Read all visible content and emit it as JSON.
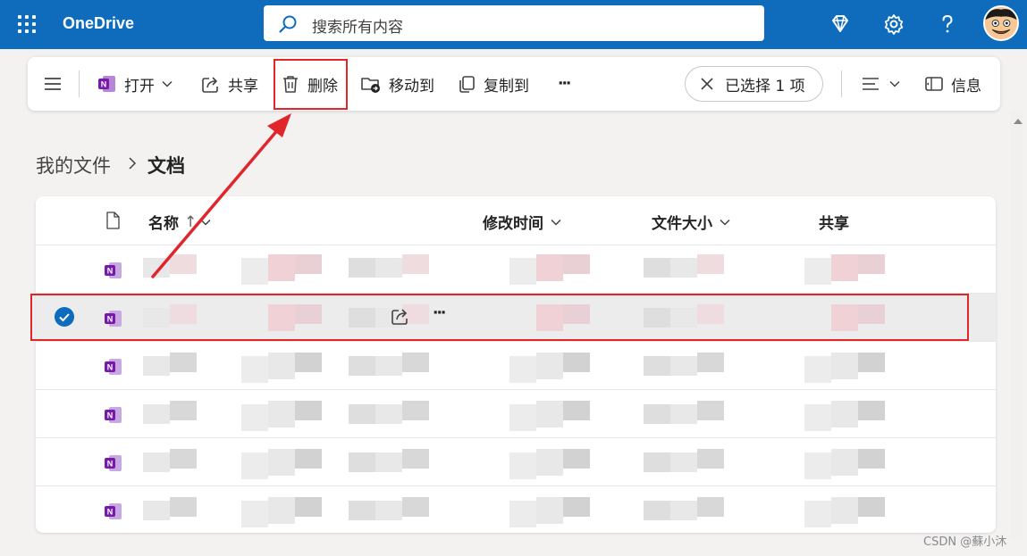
{
  "app": {
    "brand": "OneDrive"
  },
  "search": {
    "placeholder": "搜索所有内容"
  },
  "commands": {
    "open": "打开",
    "share": "共享",
    "delete": "删除",
    "move_to": "移动到",
    "copy_to": "复制到",
    "more": "···",
    "selected": "已选择 1 项",
    "info": "信息"
  },
  "breadcrumb": {
    "parent": "我的文件",
    "current": "文档"
  },
  "list": {
    "columns": {
      "name": "名称",
      "modified": "修改时间",
      "size": "文件大小",
      "sharing": "共享"
    },
    "row_count": 6,
    "selected_row_index": 1
  },
  "watermark": "CSDN @蘇小沐",
  "colors": {
    "header_bg": "#0f6cbd",
    "annotation_red": "#e0262a",
    "onenote_purple": "#7719aa"
  },
  "icons": {
    "waffle": "app-launcher-icon",
    "search": "search-icon",
    "premium": "diamond-icon",
    "settings": "gear-icon",
    "help": "question-mark-icon",
    "onenote": "onenote-file-icon"
  }
}
